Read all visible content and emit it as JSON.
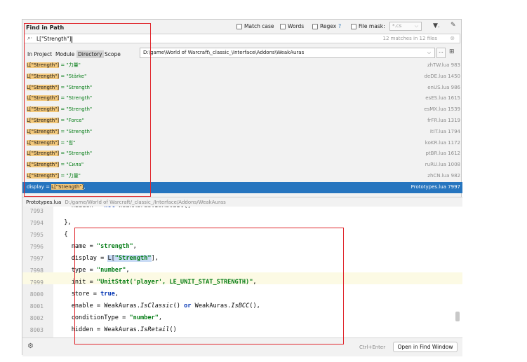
{
  "dialog": {
    "title": "Find in Path",
    "options": {
      "match_case": "Match case",
      "words": "Words",
      "regex": "Regex",
      "regex_help": "?",
      "file_mask": "File mask:",
      "file_mask_value": "*.cs"
    },
    "search": {
      "value": "L[\"Strength\"]",
      "match_count": "12 matches in 12 files"
    },
    "scope": {
      "tabs": [
        "In Project",
        "Module",
        "Directory",
        "Scope"
      ],
      "active": "Directory",
      "path": "D:\\game\\World of Warcraft\\_classic_\\Interface\\Addons\\WeakAuras",
      "browse_label": "..."
    },
    "results": [
      {
        "match": "L[\"Strength\"]",
        "rest": " = \"力量\"",
        "file": "zhTW.lua 983"
      },
      {
        "match": "L[\"Strength\"]",
        "rest": " = \"Stärke\"",
        "file": "deDE.lua 1450"
      },
      {
        "match": "L[\"Strength\"]",
        "rest": " = \"Strength\"",
        "file": "enUS.lua 986"
      },
      {
        "match": "L[\"Strength\"]",
        "rest": " = \"Strength\"",
        "file": "esES.lua 1615"
      },
      {
        "match": "L[\"Strength\"]",
        "rest": " = \"Strength\"",
        "file": "esMX.lua 1539"
      },
      {
        "match": "L[\"Strength\"]",
        "rest": " = \"Force\"",
        "file": "frFR.lua 1319"
      },
      {
        "match": "L[\"Strength\"]",
        "rest": " = \"Strength\"",
        "file": "itIT.lua 1794"
      },
      {
        "match": "L[\"Strength\"]",
        "rest": " = \"힘\"",
        "file": "koKR.lua 1172"
      },
      {
        "match": "L[\"Strength\"]",
        "rest": " = \"Strength\"",
        "file": "ptBR.lua 1612"
      },
      {
        "match": "L[\"Strength\"]",
        "rest": " = \"Сила\"",
        "file": "ruRU.lua 1008"
      },
      {
        "match": "L[\"Strength\"]",
        "rest": " = \"力量\"",
        "file": "zhCN.lua 982"
      }
    ],
    "selected_result": {
      "prefix": "display = ",
      "match": "L[\"Strength\"]",
      "suffix": ",",
      "file": "Prototypes.lua 7997"
    },
    "preview": {
      "file_name": "Prototypes.lua",
      "file_path": "D:/game/World of Warcraft/_classic_/Interface/Addons/WeakAuras",
      "line_numbers": [
        "7993",
        "7994",
        "7995",
        "7996",
        "7997",
        "7998",
        "7999",
        "8000",
        "8001",
        "8002",
        "8003"
      ],
      "current_line": "7997"
    },
    "footer": {
      "shortcut": "Ctrl+Enter",
      "open_button": "Open in Find Window"
    }
  },
  "colors": {
    "selection": "#2675bf",
    "match_highlight": "#f2c77a",
    "annotation_box": "#e0282e",
    "string": "#067d17",
    "keyword": "#0033b3"
  },
  "icons": [
    "search-icon",
    "clear-icon",
    "filter-icon",
    "pin-icon",
    "recursive-icon",
    "settings-icon",
    "dropdown-icon"
  ]
}
